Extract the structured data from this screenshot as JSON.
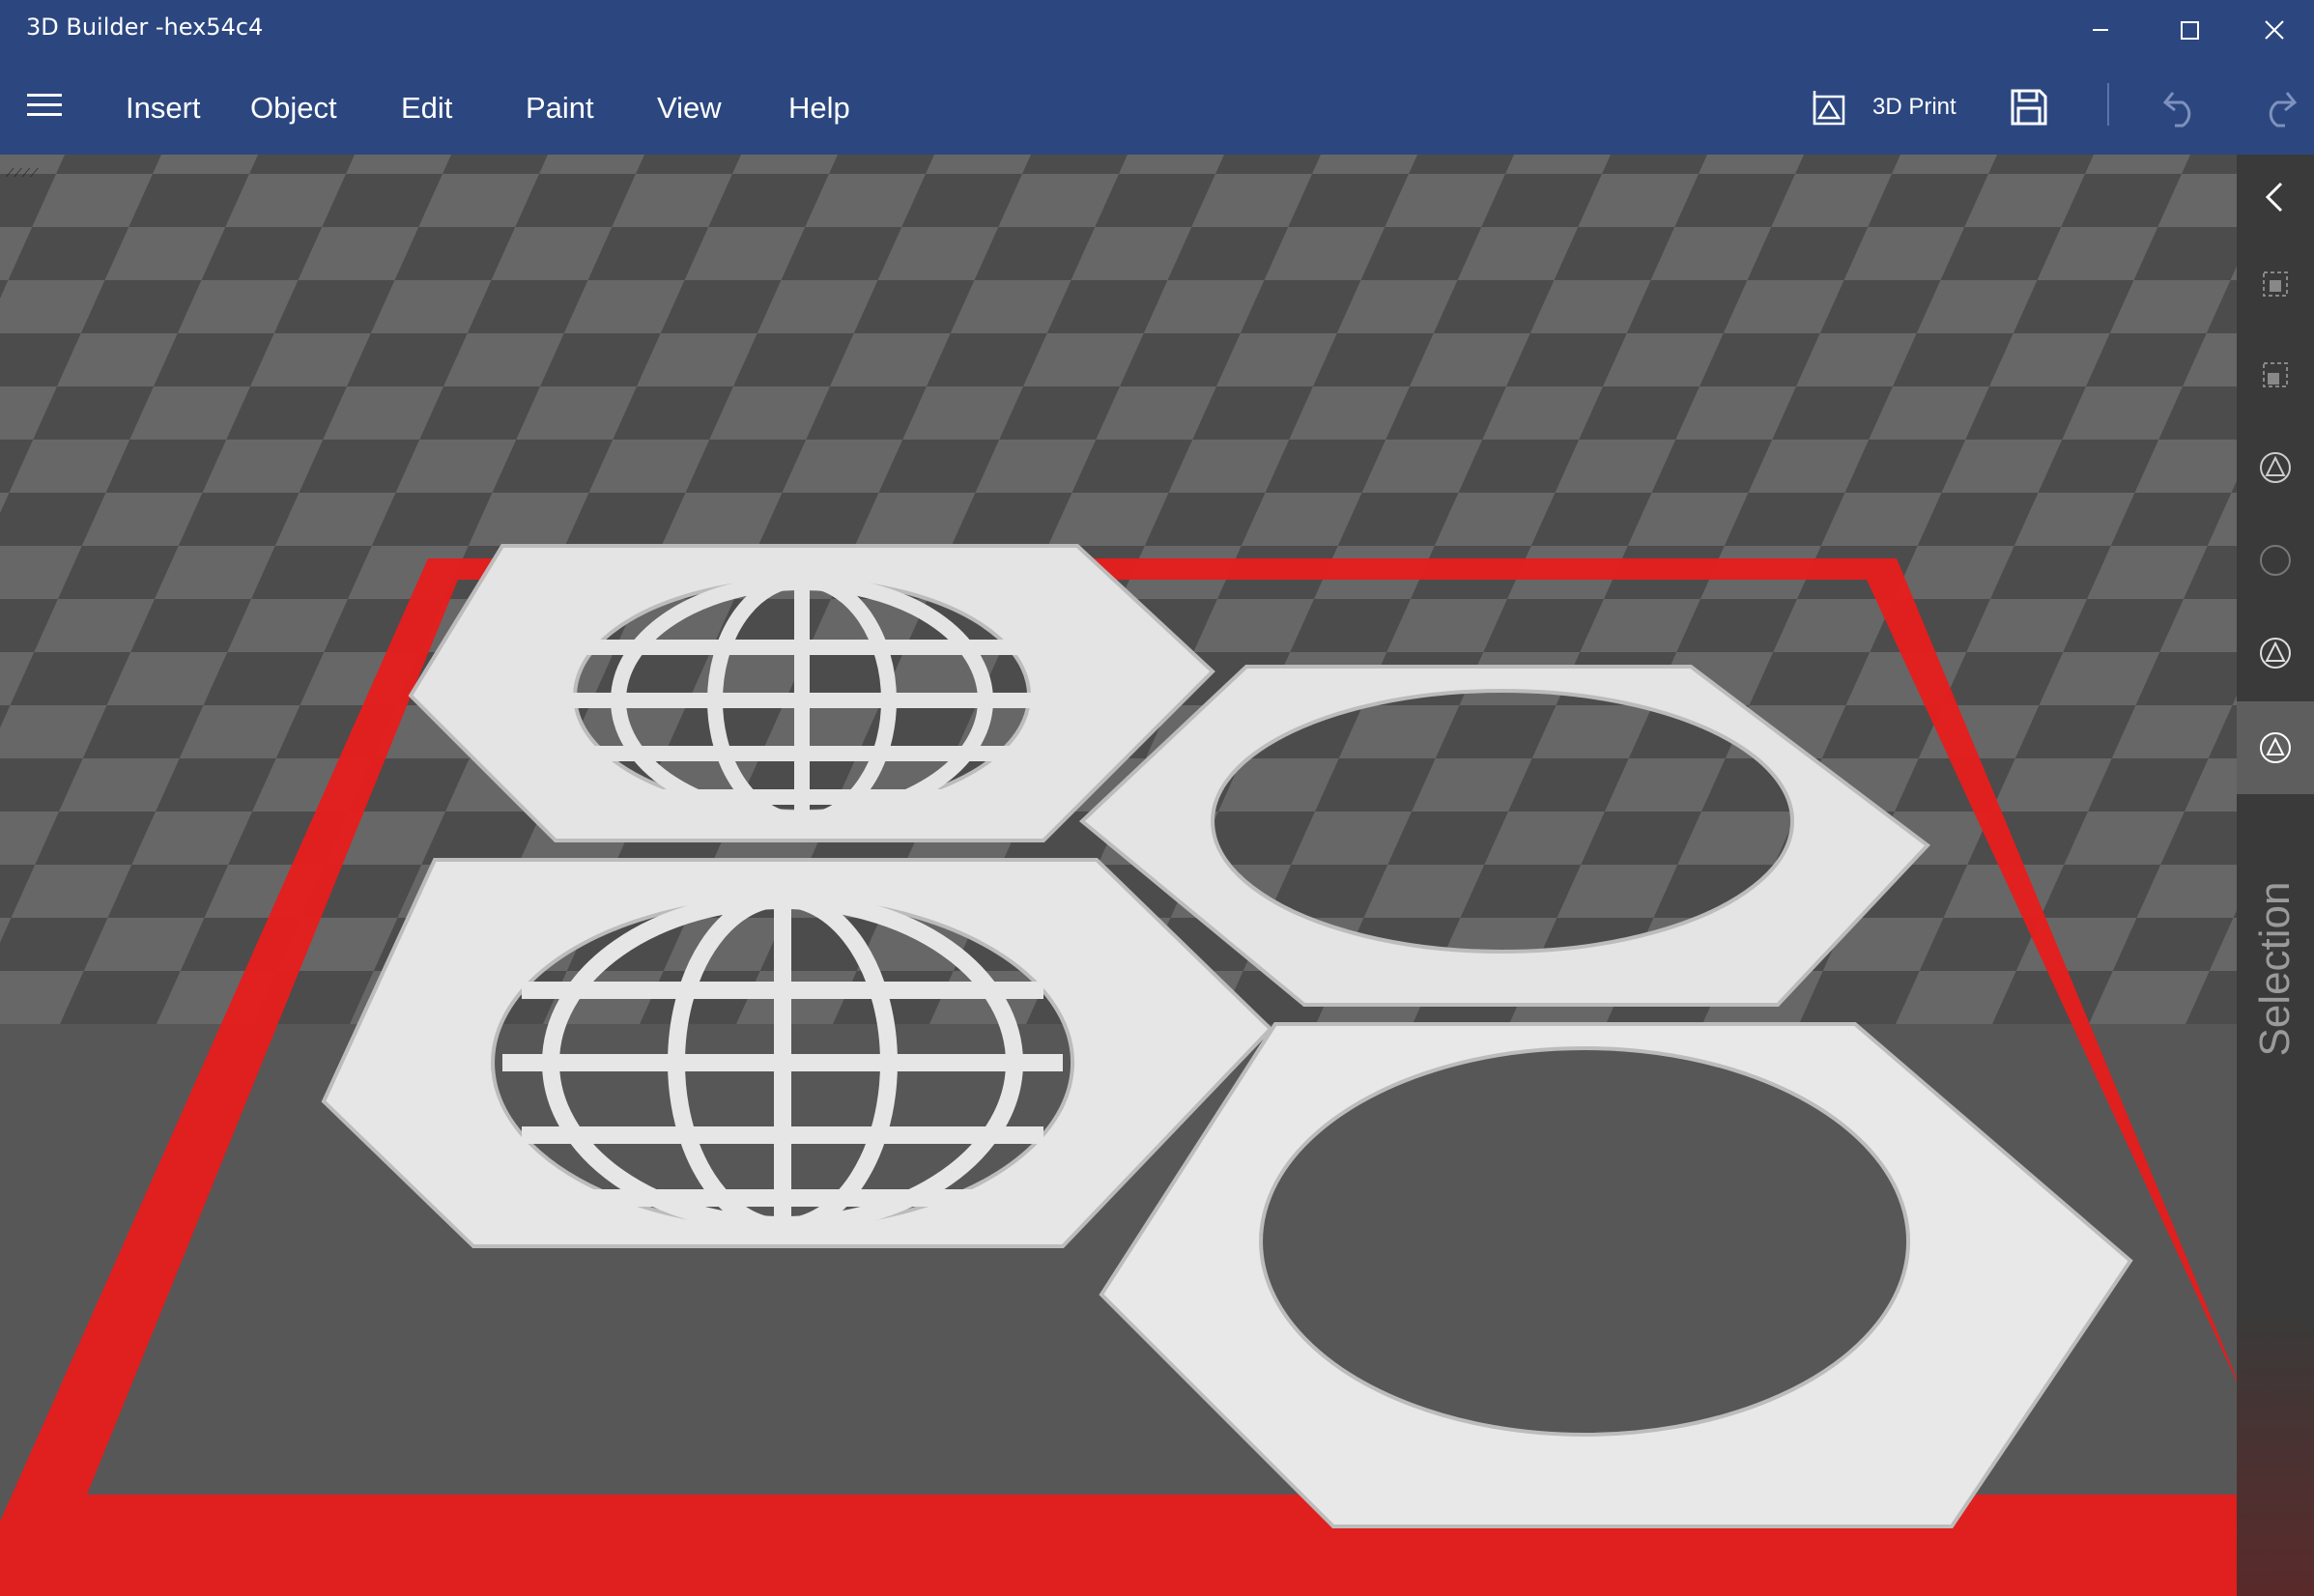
{
  "window": {
    "title": "3D Builder -hex54c4",
    "minimize_icon": "minimize-icon",
    "maximize_icon": "maximize-icon",
    "close_icon": "close-icon"
  },
  "menu": {
    "items": [
      {
        "label": "Insert"
      },
      {
        "label": "Object"
      },
      {
        "label": "Edit"
      },
      {
        "label": "Paint"
      },
      {
        "label": "View"
      },
      {
        "label": "Help"
      }
    ]
  },
  "toolbar": {
    "print_label": "3D Print",
    "print_icon": "3d-print-icon",
    "save_icon": "save-icon",
    "undo_icon": "undo-icon",
    "redo_icon": "redo-icon"
  },
  "side_panel": {
    "selection_label": "Selection",
    "icons": [
      "collapse-chevron-icon",
      "select-objects-icon",
      "select-faces-icon",
      "select-triangles-icon",
      "select-edges-icon",
      "select-vertices-icon",
      "select-mesh-icon"
    ]
  },
  "colors": {
    "title_bar": "#2c4780",
    "build_plate_outline": "#e81c1c",
    "model": "#e6e6e6",
    "checker_dark": "#4a4a4a",
    "checker_light": "#6a6a6a"
  }
}
